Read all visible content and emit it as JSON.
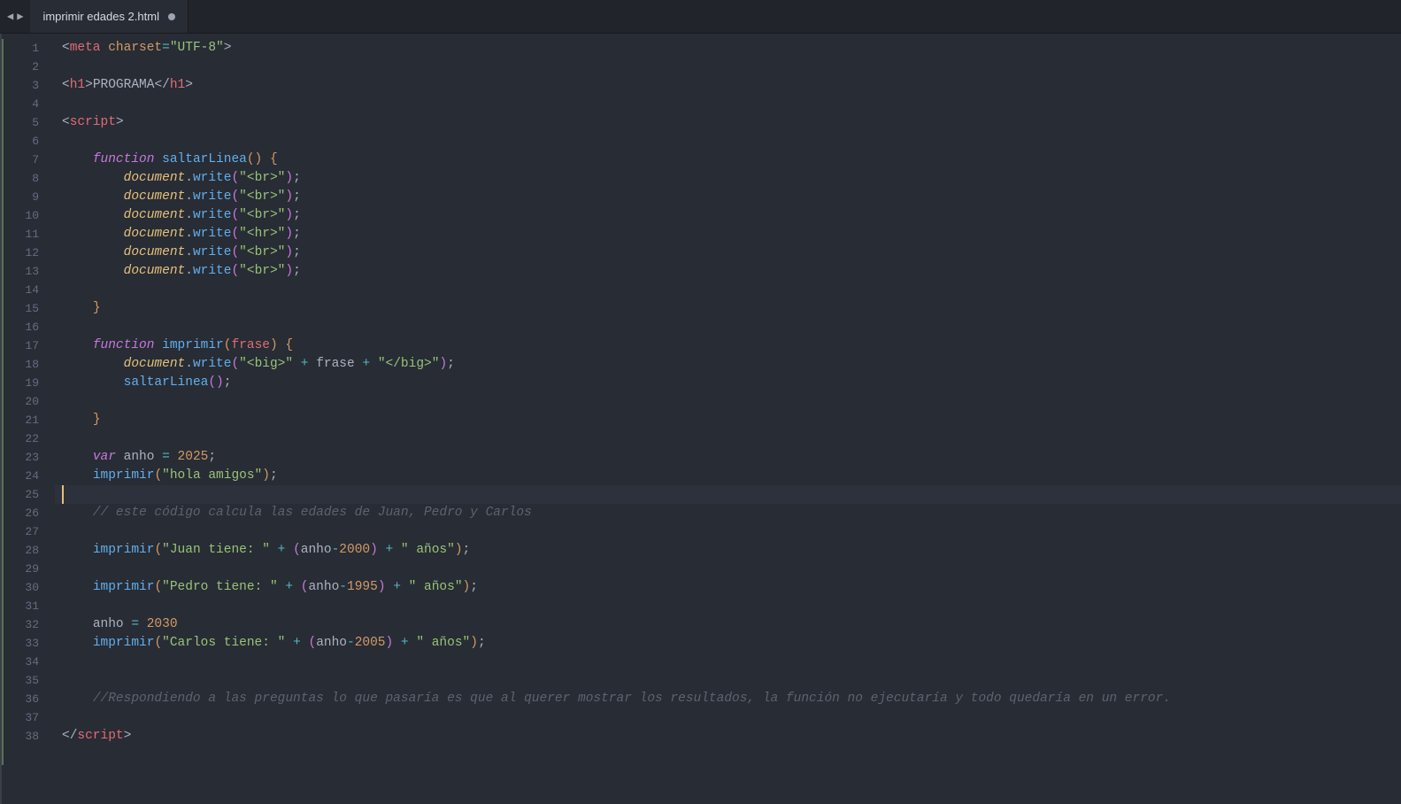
{
  "tab": {
    "title": "imprimir edades 2.html",
    "dirty": true
  },
  "gutter": {
    "start": 1,
    "end": 38,
    "current": 25
  },
  "code": {
    "lines": [
      [
        [
          "p",
          "<"
        ],
        [
          "tg",
          "meta"
        ],
        [
          "p",
          " "
        ],
        [
          "at",
          "charset"
        ],
        [
          "op",
          "="
        ],
        [
          "st",
          "\"UTF-8\""
        ],
        [
          "p",
          ">"
        ]
      ],
      [],
      [
        [
          "p",
          "<"
        ],
        [
          "tg",
          "h1"
        ],
        [
          "p",
          ">"
        ],
        [
          "wt",
          "PROGRAMA"
        ],
        [
          "p",
          "</"
        ],
        [
          "tg",
          "h1"
        ],
        [
          "p",
          ">"
        ]
      ],
      [],
      [
        [
          "p",
          "<"
        ],
        [
          "tg",
          "script"
        ],
        [
          "p",
          ">"
        ]
      ],
      [],
      [
        [
          "p",
          "    "
        ],
        [
          "kw",
          "function"
        ],
        [
          "p",
          " "
        ],
        [
          "fn",
          "saltarLinea"
        ],
        [
          "brY",
          "()"
        ],
        [
          "p",
          " "
        ],
        [
          "brY",
          "{"
        ]
      ],
      [
        [
          "p",
          "        "
        ],
        [
          "vr",
          "document"
        ],
        [
          "p",
          "."
        ],
        [
          "fn",
          "write"
        ],
        [
          "brP",
          "("
        ],
        [
          "st",
          "\"<br>\""
        ],
        [
          "brP",
          ")"
        ],
        [
          "p",
          ";"
        ]
      ],
      [
        [
          "p",
          "        "
        ],
        [
          "vr",
          "document"
        ],
        [
          "p",
          "."
        ],
        [
          "fn",
          "write"
        ],
        [
          "brP",
          "("
        ],
        [
          "st",
          "\"<br>\""
        ],
        [
          "brP",
          ")"
        ],
        [
          "p",
          ";"
        ]
      ],
      [
        [
          "p",
          "        "
        ],
        [
          "vr",
          "document"
        ],
        [
          "p",
          "."
        ],
        [
          "fn",
          "write"
        ],
        [
          "brP",
          "("
        ],
        [
          "st",
          "\"<br>\""
        ],
        [
          "brP",
          ")"
        ],
        [
          "p",
          ";"
        ]
      ],
      [
        [
          "p",
          "        "
        ],
        [
          "vr",
          "document"
        ],
        [
          "p",
          "."
        ],
        [
          "fn",
          "write"
        ],
        [
          "brP",
          "("
        ],
        [
          "st",
          "\"<hr>\""
        ],
        [
          "brP",
          ")"
        ],
        [
          "p",
          ";"
        ]
      ],
      [
        [
          "p",
          "        "
        ],
        [
          "vr",
          "document"
        ],
        [
          "p",
          "."
        ],
        [
          "fn",
          "write"
        ],
        [
          "brP",
          "("
        ],
        [
          "st",
          "\"<br>\""
        ],
        [
          "brP",
          ")"
        ],
        [
          "p",
          ";"
        ]
      ],
      [
        [
          "p",
          "        "
        ],
        [
          "vr",
          "document"
        ],
        [
          "p",
          "."
        ],
        [
          "fn",
          "write"
        ],
        [
          "brP",
          "("
        ],
        [
          "st",
          "\"<br>\""
        ],
        [
          "brP",
          ")"
        ],
        [
          "p",
          ";"
        ]
      ],
      [],
      [
        [
          "p",
          "    "
        ],
        [
          "brY",
          "}"
        ]
      ],
      [],
      [
        [
          "p",
          "    "
        ],
        [
          "kw",
          "function"
        ],
        [
          "p",
          " "
        ],
        [
          "fn",
          "imprimir"
        ],
        [
          "brY",
          "("
        ],
        [
          "id",
          "frase"
        ],
        [
          "brY",
          ")"
        ],
        [
          "p",
          " "
        ],
        [
          "brY",
          "{"
        ]
      ],
      [
        [
          "p",
          "        "
        ],
        [
          "vr",
          "document"
        ],
        [
          "p",
          "."
        ],
        [
          "fn",
          "write"
        ],
        [
          "brP",
          "("
        ],
        [
          "st",
          "\"<big>\""
        ],
        [
          "p",
          " "
        ],
        [
          "op",
          "+"
        ],
        [
          "p",
          " "
        ],
        [
          "wt",
          "frase"
        ],
        [
          "p",
          " "
        ],
        [
          "op",
          "+"
        ],
        [
          "p",
          " "
        ],
        [
          "st",
          "\"</big>\""
        ],
        [
          "brP",
          ")"
        ],
        [
          "p",
          ";"
        ]
      ],
      [
        [
          "p",
          "        "
        ],
        [
          "fn",
          "saltarLinea"
        ],
        [
          "brP",
          "()"
        ],
        [
          "p",
          ";"
        ]
      ],
      [],
      [
        [
          "p",
          "    "
        ],
        [
          "brY",
          "}"
        ]
      ],
      [],
      [
        [
          "p",
          "    "
        ],
        [
          "kw",
          "var"
        ],
        [
          "p",
          " "
        ],
        [
          "wt",
          "anho"
        ],
        [
          "p",
          " "
        ],
        [
          "op",
          "="
        ],
        [
          "p",
          " "
        ],
        [
          "nm",
          "2025"
        ],
        [
          "p",
          ";"
        ]
      ],
      [
        [
          "p",
          "    "
        ],
        [
          "fn",
          "imprimir"
        ],
        [
          "brY",
          "("
        ],
        [
          "st",
          "\"hola amigos\""
        ],
        [
          "brY",
          ")"
        ],
        [
          "p",
          ";"
        ]
      ],
      [],
      [
        [
          "p",
          "    "
        ],
        [
          "cm",
          "// este código calcula las edades de Juan, Pedro y Carlos"
        ]
      ],
      [],
      [
        [
          "p",
          "    "
        ],
        [
          "fn",
          "imprimir"
        ],
        [
          "brY",
          "("
        ],
        [
          "st",
          "\"Juan tiene: \""
        ],
        [
          "p",
          " "
        ],
        [
          "op",
          "+"
        ],
        [
          "p",
          " "
        ],
        [
          "brP",
          "("
        ],
        [
          "wt",
          "anho"
        ],
        [
          "op",
          "-"
        ],
        [
          "nm",
          "2000"
        ],
        [
          "brP",
          ")"
        ],
        [
          "p",
          " "
        ],
        [
          "op",
          "+"
        ],
        [
          "p",
          " "
        ],
        [
          "st",
          "\" años\""
        ],
        [
          "brY",
          ")"
        ],
        [
          "p",
          ";"
        ]
      ],
      [],
      [
        [
          "p",
          "    "
        ],
        [
          "fn",
          "imprimir"
        ],
        [
          "brY",
          "("
        ],
        [
          "st",
          "\"Pedro tiene: \""
        ],
        [
          "p",
          " "
        ],
        [
          "op",
          "+"
        ],
        [
          "p",
          " "
        ],
        [
          "brP",
          "("
        ],
        [
          "wt",
          "anho"
        ],
        [
          "op",
          "-"
        ],
        [
          "nm",
          "1995"
        ],
        [
          "brP",
          ")"
        ],
        [
          "p",
          " "
        ],
        [
          "op",
          "+"
        ],
        [
          "p",
          " "
        ],
        [
          "st",
          "\" años\""
        ],
        [
          "brY",
          ")"
        ],
        [
          "p",
          ";"
        ]
      ],
      [],
      [
        [
          "p",
          "    "
        ],
        [
          "wt",
          "anho"
        ],
        [
          "p",
          " "
        ],
        [
          "op",
          "="
        ],
        [
          "p",
          " "
        ],
        [
          "nm",
          "2030"
        ]
      ],
      [
        [
          "p",
          "    "
        ],
        [
          "fn",
          "imprimir"
        ],
        [
          "brY",
          "("
        ],
        [
          "st",
          "\"Carlos tiene: \""
        ],
        [
          "p",
          " "
        ],
        [
          "op",
          "+"
        ],
        [
          "p",
          " "
        ],
        [
          "brP",
          "("
        ],
        [
          "wt",
          "anho"
        ],
        [
          "op",
          "-"
        ],
        [
          "nm",
          "2005"
        ],
        [
          "brP",
          ")"
        ],
        [
          "p",
          " "
        ],
        [
          "op",
          "+"
        ],
        [
          "p",
          " "
        ],
        [
          "st",
          "\" años\""
        ],
        [
          "brY",
          ")"
        ],
        [
          "p",
          ";"
        ]
      ],
      [],
      [],
      [
        [
          "p",
          "    "
        ],
        [
          "cm",
          "//Respondiendo a las preguntas lo que pasaría es que al querer mostrar los resultados, la función no ejecutaría y todo quedaría en un error."
        ]
      ],
      [],
      [
        [
          "p",
          "</"
        ],
        [
          "tg",
          "script"
        ],
        [
          "p",
          ">"
        ]
      ]
    ]
  }
}
